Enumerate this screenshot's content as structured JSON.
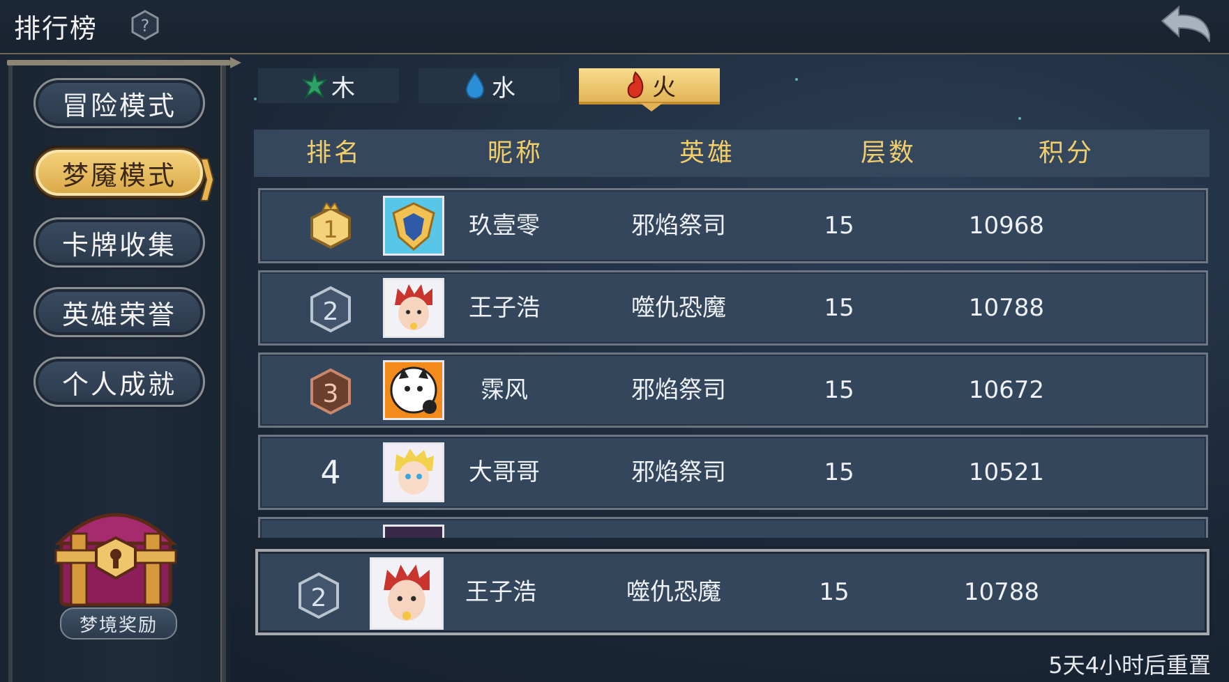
{
  "header": {
    "title": "排行榜",
    "help_icon": "question-icon",
    "back_icon": "back-arrow-icon"
  },
  "sidebar": {
    "items": [
      {
        "label": "冒险模式",
        "active": false
      },
      {
        "label": "梦魇模式",
        "active": true
      },
      {
        "label": "卡牌收集",
        "active": false
      },
      {
        "label": "英雄荣誉",
        "active": false
      },
      {
        "label": "个人成就",
        "active": false
      }
    ],
    "reward_label": "梦境奖励"
  },
  "tabs": [
    {
      "label": "木",
      "icon": "leaf-icon",
      "active": false
    },
    {
      "label": "水",
      "icon": "water-drop-icon",
      "active": false
    },
    {
      "label": "火",
      "icon": "fire-icon",
      "active": true
    }
  ],
  "table": {
    "headers": [
      "排名",
      "昵称",
      "英雄",
      "层数",
      "积分"
    ],
    "rows": [
      {
        "rank": "1",
        "name": "玖壹零",
        "hero": "邪焰祭司",
        "floor": "15",
        "score": "10968"
      },
      {
        "rank": "2",
        "name": "王子浩",
        "hero": "噬仇恐魔",
        "floor": "15",
        "score": "10788"
      },
      {
        "rank": "3",
        "name": "霂风",
        "hero": "邪焰祭司",
        "floor": "15",
        "score": "10672"
      },
      {
        "rank": "4",
        "name": "大哥哥",
        "hero": "邪焰祭司",
        "floor": "15",
        "score": "10521"
      }
    ]
  },
  "my_rank": {
    "rank": "2",
    "name": "王子浩",
    "hero": "噬仇恐魔",
    "floor": "15",
    "score": "10788"
  },
  "reset_text": "5天4小时后重置",
  "colors": {
    "gold": "#f2ce6a",
    "panel": "#34465b",
    "bg": "#1d2a3b"
  }
}
